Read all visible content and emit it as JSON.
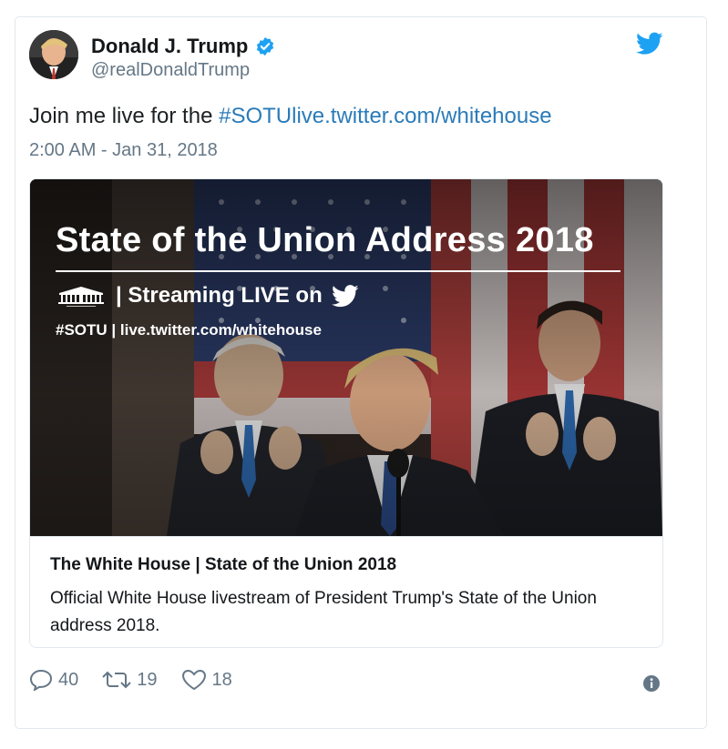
{
  "author": {
    "display_name": "Donald J. Trump",
    "screen_name": "@realDonaldTrump",
    "verified_icon": "verified-badge-icon"
  },
  "tweet": {
    "text_prefix": "Join me live for the ",
    "hashtag_link": "#SOTUlive.twitter.com/whitehouse",
    "timestamp": "2:00 AM - Jan 31, 2018"
  },
  "media": {
    "overlay_title": "State of the Union Address 2018",
    "overlay_streaming": "| Streaming LIVE on",
    "overlay_tags": "#SOTU | live.twitter.com/whitehouse",
    "card_title": "The White House | State of the Union 2018",
    "card_description": "Official White House livestream of President Trump's State of the Union address 2018."
  },
  "actions": {
    "replies": "40",
    "retweets": "19",
    "likes": "18"
  },
  "colors": {
    "link": "#2b7bb9",
    "twitter_blue": "#1da1f2",
    "muted": "#657786"
  }
}
